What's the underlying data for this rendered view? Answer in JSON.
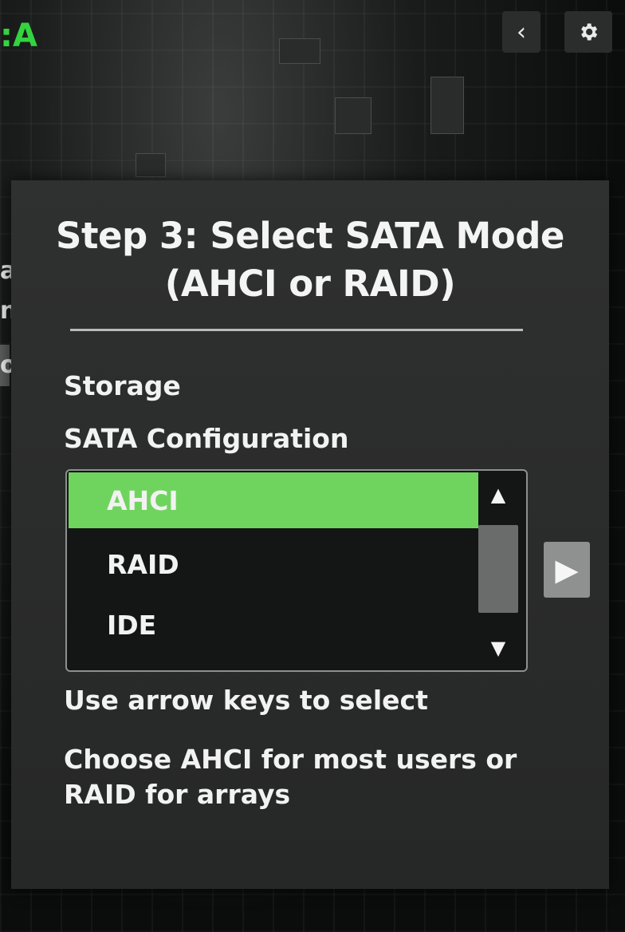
{
  "header": {
    "fragment_label": ":A",
    "side_fragments": [
      "a",
      "n",
      "o"
    ]
  },
  "dialog": {
    "title_line1": "Step 3: Select SATA Mode",
    "title_line2": "(AHCI or RAID)",
    "section_label": "Storage",
    "field_label": "SATA Configuration",
    "options": [
      {
        "label": "AHCI",
        "selected": true
      },
      {
        "label": "RAID",
        "selected": false
      },
      {
        "label": "IDE",
        "selected": false
      }
    ],
    "hint1": "Use arrow keys to select",
    "hint2": "Choose AHCI for most users or RAID for arrays"
  },
  "icons": {
    "back": "chevron-left",
    "settings": "gear",
    "scroll_up": "triangle-up",
    "scroll_down": "triangle-down",
    "next": "play-triangle"
  },
  "colors": {
    "accent_green": "#6fd45e",
    "label_green": "#33d43f"
  }
}
